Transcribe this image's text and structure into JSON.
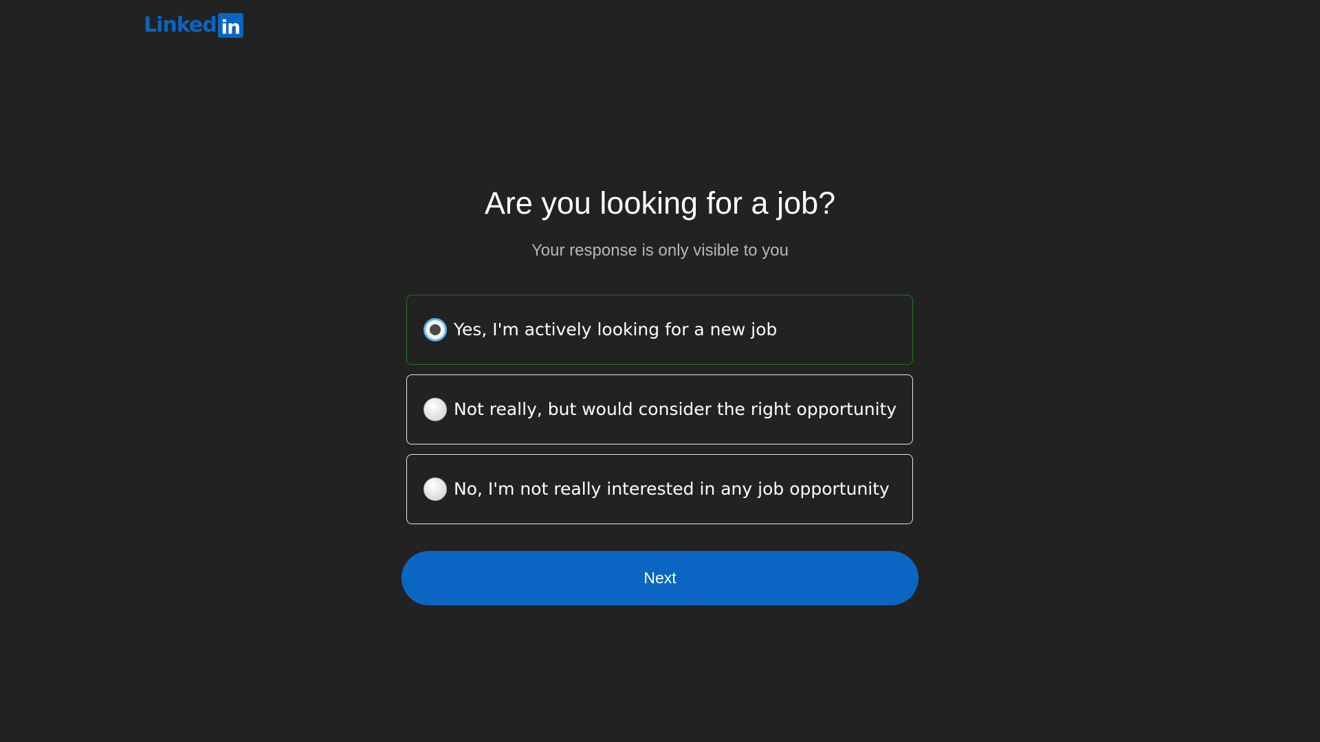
{
  "logo": {
    "text": "Linked",
    "box_text": "in",
    "icon": "linkedin-logo",
    "brand_color": "#0a66c2"
  },
  "question": {
    "title": "Are you looking for a job?",
    "subtitle": "Your response is only visible to you"
  },
  "options": [
    {
      "label": "Yes, I'm actively looking for a new job",
      "selected": true
    },
    {
      "label": "Not really, but would consider the right opportunity",
      "selected": false
    },
    {
      "label": "No, I'm not really interested in any job opportunity",
      "selected": false
    }
  ],
  "actions": {
    "next_label": "Next"
  },
  "colors": {
    "background": "#222222",
    "selected_border": "#1f7a1f",
    "radio_focus": "#5fb6e6"
  }
}
